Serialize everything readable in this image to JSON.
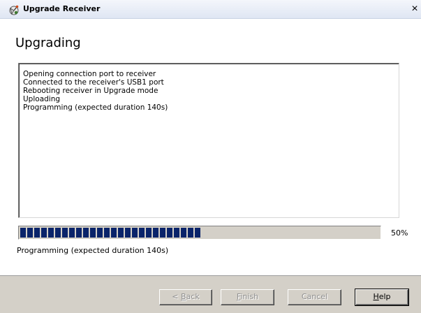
{
  "window": {
    "title": "Upgrade Receiver",
    "close_label": "×",
    "icon": "satellite-icon"
  },
  "page": {
    "heading": "Upgrading"
  },
  "log": {
    "lines": [
      "Opening connection port to receiver",
      "Connected to the receiver's USB1 port",
      "Rebooting receiver in Upgrade mode",
      "Uploading",
      "Programming (expected duration 140s)"
    ]
  },
  "progress": {
    "percent_label": "50%",
    "value": 0.5,
    "status": "Programming (expected duration 140s)",
    "fill_color": "#0a246a"
  },
  "buttons": {
    "back": {
      "prefix": "< ",
      "mnemonic": "B",
      "rest": "ack",
      "enabled": false
    },
    "finish": {
      "prefix": "",
      "mnemonic": "F",
      "rest": "inish",
      "enabled": false
    },
    "cancel": {
      "prefix": "",
      "mnemonic": "",
      "rest": "Cancel",
      "enabled": false
    },
    "help": {
      "prefix": "",
      "mnemonic": "H",
      "rest": "elp",
      "enabled": true
    }
  }
}
